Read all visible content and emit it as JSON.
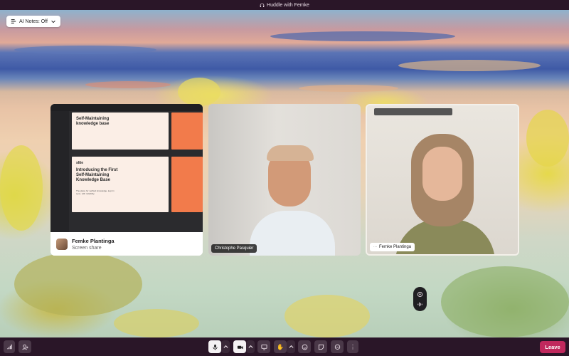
{
  "window": {
    "title": "Huddle with Femke"
  },
  "ai_notes": {
    "label": "AI Notes: Off"
  },
  "tiles": [
    {
      "name": "Femke Plantinga",
      "subtitle": "Screen share"
    },
    {
      "name": "Christophe Pasquier"
    },
    {
      "name": "Femke Plantinga"
    }
  ],
  "slides": {
    "top_title": "Self-Maintaining knowledge base",
    "main_brand": "slite",
    "main_title": "Introducing the First Self-Maintaining Knowledge Base",
    "main_sub": "The place for verified knowledge, kept in sync, with reliability."
  },
  "toolbar": {
    "leave_label": "Leave"
  },
  "colors": {
    "accent_leave": "#c0285d",
    "chrome": "#2a1628"
  }
}
